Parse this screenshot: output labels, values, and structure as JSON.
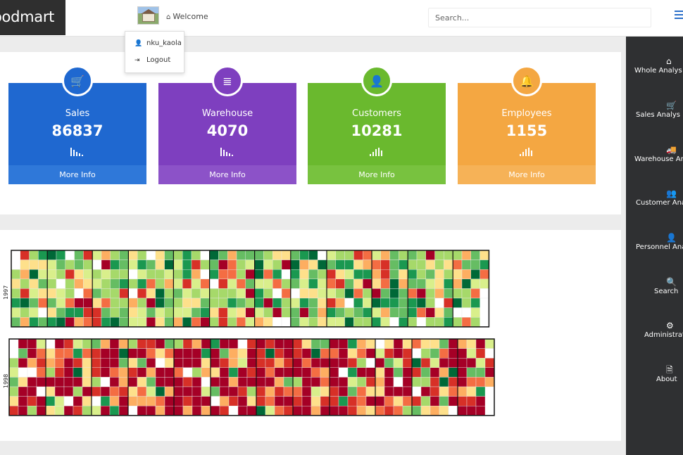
{
  "header": {
    "brand": "oodmart",
    "welcome": "Welcome",
    "search_placeholder": "Search..."
  },
  "dropdown": {
    "items": [
      {
        "icon": "user-icon",
        "label": "nku_kaola"
      },
      {
        "icon": "logout-icon",
        "label": "Logout"
      }
    ]
  },
  "cards": [
    {
      "label": "Sales",
      "value": "86837",
      "more": "More Info",
      "color": "#1f68d0",
      "icon": "cart-icon"
    },
    {
      "label": "Warehouse",
      "value": "4070",
      "more": "More Info",
      "color": "#7e3fbf",
      "icon": "list-icon"
    },
    {
      "label": "Customers",
      "value": "10281",
      "more": "More Info",
      "color": "#6ab92e",
      "icon": "user-icon"
    },
    {
      "label": "Employees",
      "value": "1155",
      "more": "More Info",
      "color": "#f4a742",
      "icon": "bell-icon"
    }
  ],
  "sidebar": {
    "items": [
      {
        "icon": "home-icon",
        "label": "Whole Analys"
      },
      {
        "icon": "cart-icon",
        "label": "Sales Analys"
      },
      {
        "icon": "truck-icon",
        "label": "Warehouse Anal"
      },
      {
        "icon": "users-icon",
        "label": "Customer Anal"
      },
      {
        "icon": "user-icon",
        "label": "Personnel Anal"
      },
      {
        "icon": "search-icon",
        "label": "Search"
      },
      {
        "icon": "cogs-icon",
        "label": "Administratio"
      },
      {
        "icon": "file-icon",
        "label": "About"
      }
    ]
  },
  "calendar": {
    "years": [
      "1997",
      "1998"
    ],
    "palette": [
      "#a50026",
      "#d73027",
      "#f46d43",
      "#fdae61",
      "#fee08b",
      "#d9ef8b",
      "#a6d96a",
      "#66bd63",
      "#1a9850",
      "#006837"
    ]
  }
}
